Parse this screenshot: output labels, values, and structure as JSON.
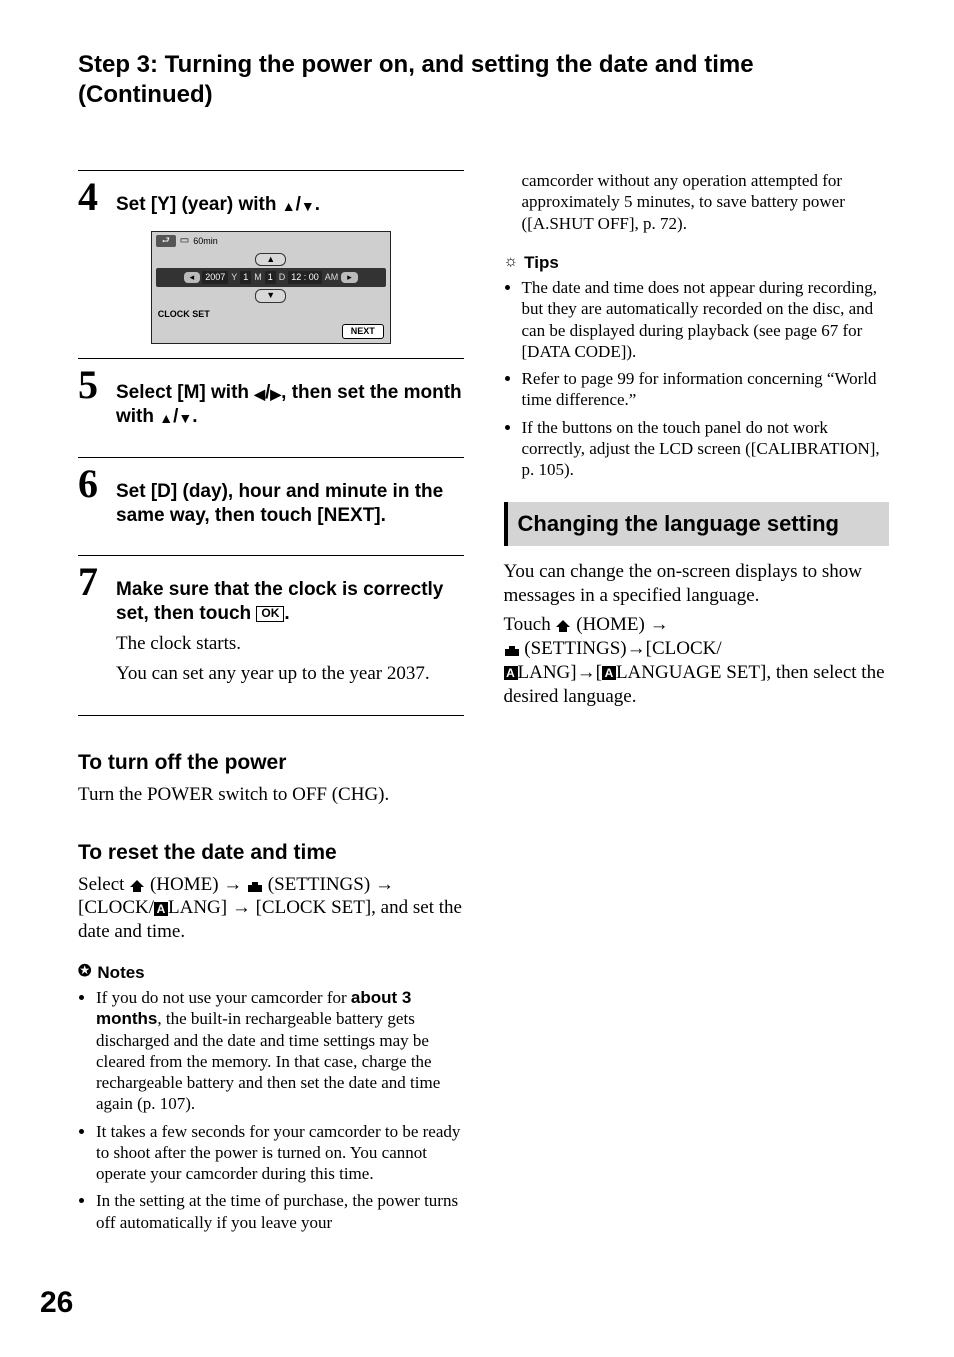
{
  "contTitle": "Step 3: Turning the power on, and setting the date and time (Continued)",
  "steps": {
    "s4": {
      "num": "4",
      "title_pre": "Set [Y] (year) with ",
      "title_post": "."
    },
    "s5": {
      "num": "5",
      "title_pre": "Select [M] with ",
      "title_mid": ", then set the month with ",
      "title_post": "."
    },
    "s6": {
      "num": "6",
      "title": "Set [D] (day), hour and minute in the same way, then touch [NEXT]."
    },
    "s7": {
      "num": "7",
      "title_pre": "Make sure that the clock is correctly set, then touch ",
      "title_post": ".",
      "ok": "OK",
      "body1": "The clock starts.",
      "body2": "You can set any year up to the year 2037."
    }
  },
  "lcd": {
    "batt": "60min",
    "year": "2007",
    "y": "Y",
    "m": "M",
    "mval": "1",
    "d": "D",
    "dval": "1",
    "time": "12 : 00",
    "ampm": "AM",
    "clockset": "CLOCK SET",
    "next": "NEXT"
  },
  "sub1": {
    "head": "To turn off the power",
    "body": "Turn the POWER switch to OFF (CHG)."
  },
  "sub2": {
    "head": "To reset the date and time",
    "body_pre": "Select ",
    "home": " (HOME) ",
    "settings": "(SETTINGS) ",
    "arrow": "→",
    "clocklang_pre": " [CLOCK/",
    "clocklang_post": "LANG] ",
    "clockset": " [CLOCK SET], and set the date and time."
  },
  "notesHead": "Notes",
  "notes": [
    {
      "pre": "If you do not use your camcorder for ",
      "bold": "about 3 months",
      "post": ", the built-in rechargeable battery gets discharged and the date and time settings may be cleared from the memory. In that case, charge the rechargeable battery and then set the date and time again (p. 107)."
    },
    {
      "text": "It takes a few seconds for your camcorder to be ready to shoot after the power is turned on. You cannot operate your camcorder during this time."
    },
    {
      "text": "In the setting at the time of purchase, the power turns off automatically if you leave your"
    }
  ],
  "col2top": "camcorder without any operation attempted for approximately 5 minutes, to save battery power ([A.SHUT OFF], p. 72).",
  "tipsHead": "Tips",
  "tips": [
    "The date and time does not appear during recording, but they are automatically recorded on the disc, and can be displayed during playback (see page 67 for [DATA CODE]).",
    "Refer to page 99 for information concerning “World time difference.”",
    "If the buttons on the touch panel do not work correctly, adjust the LCD screen ([CALIBRATION], p. 105)."
  ],
  "sectionBar": "Changing the language setting",
  "lang": {
    "p1": "You can change the on-screen displays to show messages in a specified language.",
    "touch": "Touch ",
    "home": " (HOME) ",
    "arrow": "→",
    "settings": "(SETTINGS)",
    "clock": "[CLOCK/",
    "lang1": "LANG]",
    "lang2_pre": "[",
    "lang2_post": "LANGUAGE SET], then select the desired language."
  },
  "pageNum": "26",
  "glyphs": {
    "up": "▲",
    "down": "▼",
    "left": "◀",
    "right": "▶",
    "slash": "/",
    "A": "A"
  }
}
